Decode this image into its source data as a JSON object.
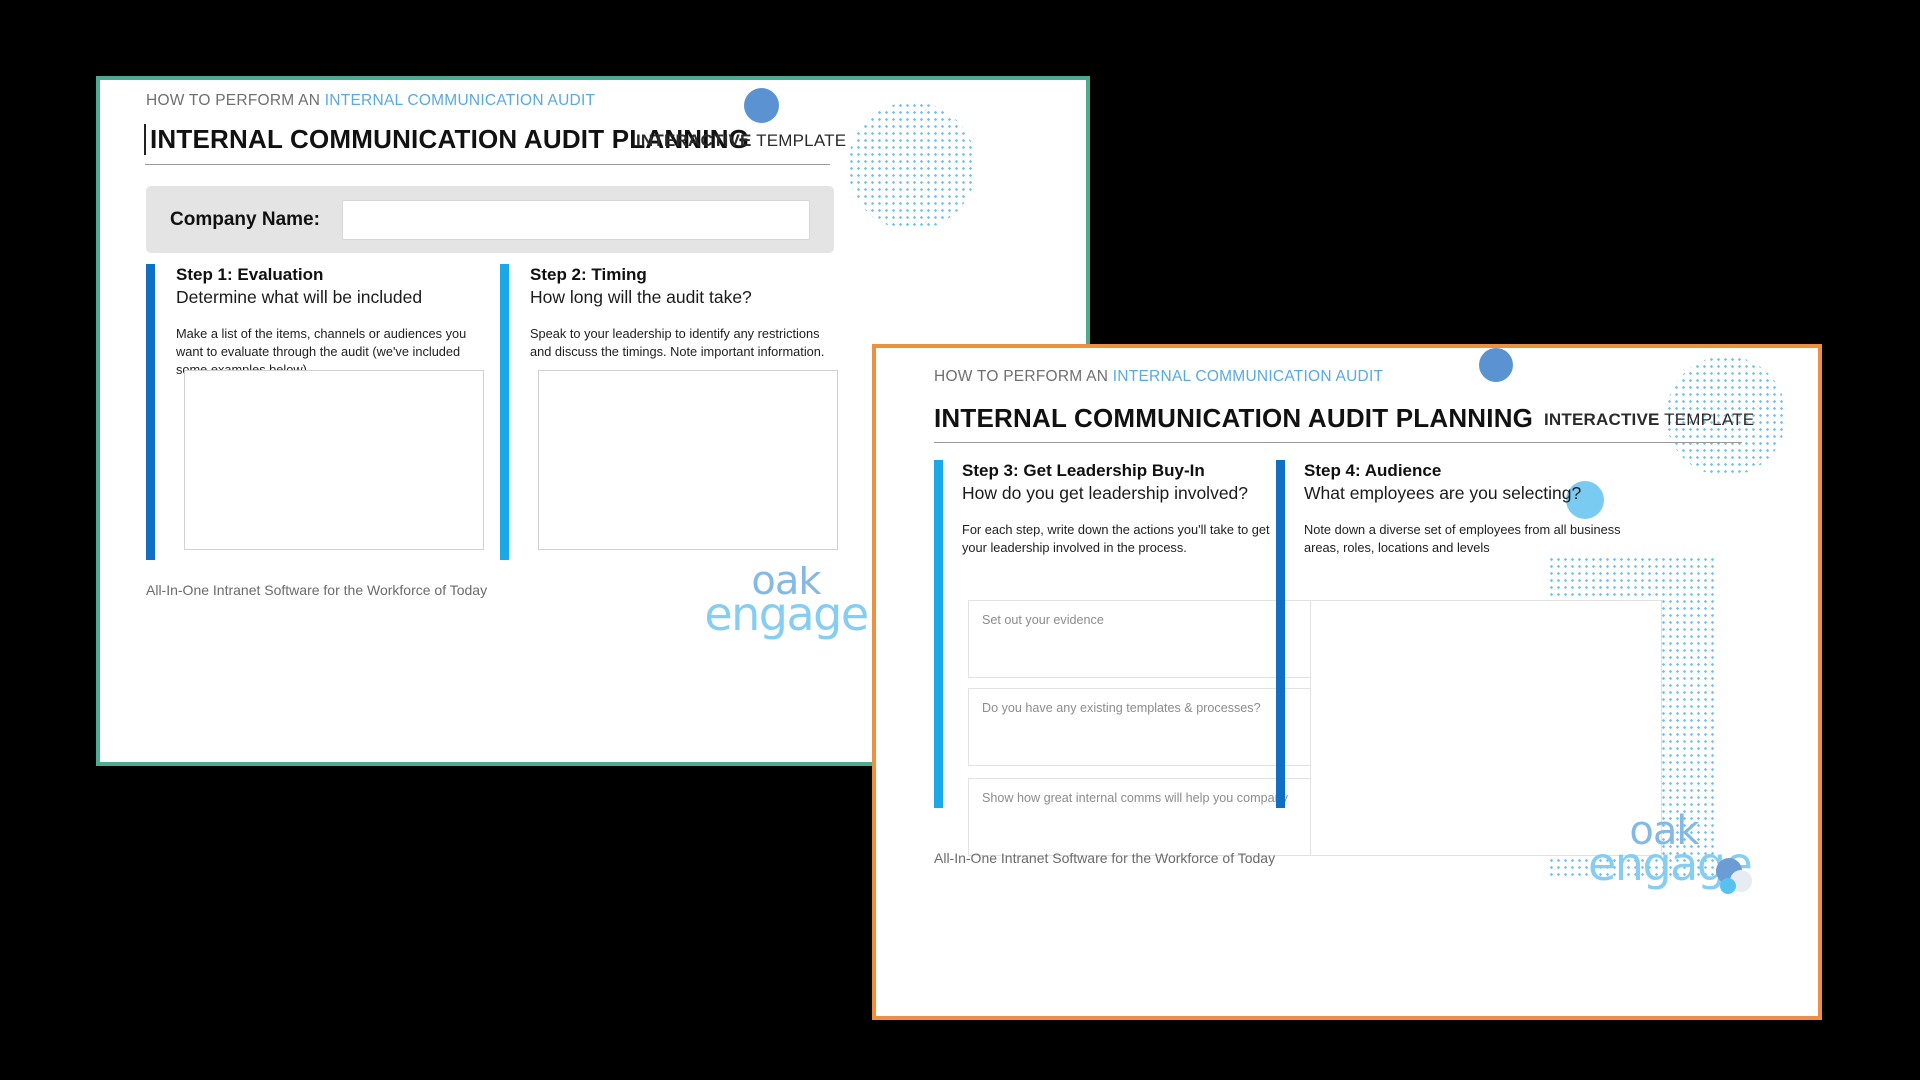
{
  "theme": {
    "back_border": "#4cab91",
    "front_border": "#ef8f41",
    "accent_blue": "#59a9e3",
    "step_bar_dark": "#0f6fc5",
    "step_bar_light": "#1aa8e8",
    "dot_pattern": "#6fc0ee",
    "page_bg": "#000000"
  },
  "documents": [
    {
      "id": "page-1",
      "kicker_lead": "HOW TO PERFORM AN ",
      "kicker_accent": "INTERNAL COMMUNICATION AUDIT",
      "title": "INTERNAL COMMUNICATION AUDIT PLANNING",
      "kind_bold": "INTERACTIVE",
      "kind_rest": " TEMPLATE",
      "company": {
        "label": "Company Name:",
        "value": "",
        "placeholder": ""
      },
      "steps": [
        {
          "title": "Step 1: Evaluation",
          "subtitle": "Determine what will be included",
          "description": "Make a list of the items, channels or audiences you want to evaluate through the audit (we've included some examples below).",
          "answer_placeholder": ""
        },
        {
          "title": "Step 2: Timing",
          "subtitle": "How long will the audit take?",
          "description": "Speak to your leadership to identify any restrictions and discuss the timings. Note important information.",
          "answer_placeholder": ""
        }
      ],
      "footer": "All-In-One Intranet Software for the Workforce of Today",
      "logo": {
        "line1": "oak",
        "line2": "engage"
      }
    },
    {
      "id": "page-2",
      "kicker_lead": "HOW TO PERFORM AN ",
      "kicker_accent": "INTERNAL COMMUNICATION AUDIT",
      "title": "INTERNAL COMMUNICATION AUDIT PLANNING",
      "kind_bold": "INTERACTIVE",
      "kind_rest": " TEMPLATE",
      "steps": [
        {
          "title": "Step 3: Get Leadership Buy-In",
          "subtitle": "How do you get leadership involved?",
          "description": "For each step, write down the actions you'll take to get your leadership involved in the process.",
          "fields": [
            {
              "placeholder": "Set out your evidence",
              "value": ""
            },
            {
              "placeholder": "Do you have any existing templates & processes?",
              "value": ""
            },
            {
              "placeholder": "Show how great internal comms will help you company",
              "value": ""
            }
          ]
        },
        {
          "title": "Step 4: Audience",
          "subtitle": "What employees are you selecting?",
          "description": "Note down a diverse set of employees from all business areas, roles, locations and levels",
          "fields": [
            {
              "placeholder": "",
              "value": ""
            }
          ]
        }
      ],
      "footer": "All-In-One Intranet Software for the Workforce of Today",
      "logo": {
        "line1": "oak",
        "line2": "engage"
      }
    }
  ]
}
